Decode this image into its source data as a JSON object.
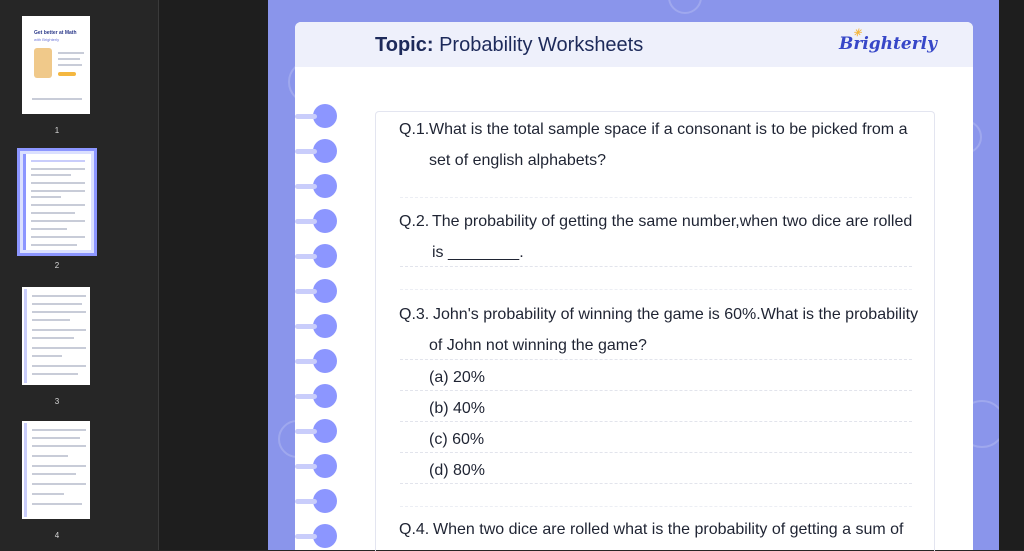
{
  "thumbnails": [
    {
      "page": "1",
      "title": "Get better at Math",
      "subtitle": "with Brighterly",
      "selected": false
    },
    {
      "page": "2",
      "selected": true
    },
    {
      "page": "3",
      "selected": false
    },
    {
      "page": "4",
      "selected": false
    }
  ],
  "header": {
    "topic_label": "Topic:",
    "topic_title": "Probability Worksheets",
    "brand": "Brighterly"
  },
  "questions": [
    {
      "num": "Q.1.",
      "line1": "What is the total sample space if a consonant is to be picked from a",
      "line2": "set of english alphabets?"
    },
    {
      "num": "Q.2.",
      "line1": "The probability of getting the same number,when two dice are rolled",
      "line2": "is ________."
    },
    {
      "num": "Q.3.",
      "line1": "John's probability of winning the game is 60%.What is the probability",
      "line2": "of John not winning the game?",
      "options": [
        "(a)  20%",
        "(b)  40%",
        "(c)  60%",
        "(d)  80%"
      ]
    },
    {
      "num": "Q.4.",
      "line1": "When two dice are rolled what is the probability of getting a sum of"
    }
  ],
  "colors": {
    "accent": "#8c96ff",
    "sheet": "#8a95eb",
    "title": "#1d2a5a",
    "brand": "#3747c8"
  }
}
